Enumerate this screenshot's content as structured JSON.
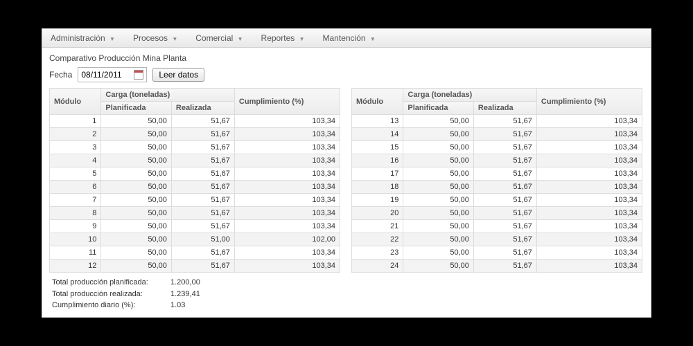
{
  "menu": {
    "items": [
      "Administración",
      "Procesos",
      "Comercial",
      "Reportes",
      "Mantención"
    ]
  },
  "page_title": "Comparativo Producción Mina Planta",
  "controls": {
    "fecha_label": "Fecha",
    "fecha_value": "08/11/2011",
    "leer_label": "Leer datos"
  },
  "table_headers": {
    "modulo": "Módulo",
    "carga": "Carga (toneladas)",
    "planificada": "Planificada",
    "realizada": "Realizada",
    "cumplimiento": "Cumplimiento (%)"
  },
  "rows_left": [
    {
      "m": "1",
      "p": "50,00",
      "r": "51,67",
      "c": "103,34"
    },
    {
      "m": "2",
      "p": "50,00",
      "r": "51,67",
      "c": "103,34"
    },
    {
      "m": "3",
      "p": "50,00",
      "r": "51,67",
      "c": "103,34"
    },
    {
      "m": "4",
      "p": "50,00",
      "r": "51,67",
      "c": "103,34"
    },
    {
      "m": "5",
      "p": "50,00",
      "r": "51,67",
      "c": "103,34"
    },
    {
      "m": "6",
      "p": "50,00",
      "r": "51,67",
      "c": "103,34"
    },
    {
      "m": "7",
      "p": "50,00",
      "r": "51,67",
      "c": "103,34"
    },
    {
      "m": "8",
      "p": "50,00",
      "r": "51,67",
      "c": "103,34"
    },
    {
      "m": "9",
      "p": "50,00",
      "r": "51,67",
      "c": "103,34"
    },
    {
      "m": "10",
      "p": "50,00",
      "r": "51,00",
      "c": "102,00"
    },
    {
      "m": "11",
      "p": "50,00",
      "r": "51,67",
      "c": "103,34"
    },
    {
      "m": "12",
      "p": "50,00",
      "r": "51,67",
      "c": "103,34"
    }
  ],
  "rows_right": [
    {
      "m": "13",
      "p": "50,00",
      "r": "51,67",
      "c": "103,34"
    },
    {
      "m": "14",
      "p": "50,00",
      "r": "51,67",
      "c": "103,34"
    },
    {
      "m": "15",
      "p": "50,00",
      "r": "51,67",
      "c": "103,34"
    },
    {
      "m": "16",
      "p": "50,00",
      "r": "51,67",
      "c": "103,34"
    },
    {
      "m": "17",
      "p": "50,00",
      "r": "51,67",
      "c": "103,34"
    },
    {
      "m": "18",
      "p": "50,00",
      "r": "51,67",
      "c": "103,34"
    },
    {
      "m": "19",
      "p": "50,00",
      "r": "51,67",
      "c": "103,34"
    },
    {
      "m": "20",
      "p": "50,00",
      "r": "51,67",
      "c": "103,34"
    },
    {
      "m": "21",
      "p": "50,00",
      "r": "51,67",
      "c": "103,34"
    },
    {
      "m": "22",
      "p": "50,00",
      "r": "51,67",
      "c": "103,34"
    },
    {
      "m": "23",
      "p": "50,00",
      "r": "51,67",
      "c": "103,34"
    },
    {
      "m": "24",
      "p": "50,00",
      "r": "51,67",
      "c": "103,34"
    }
  ],
  "totals": {
    "planificada_label": "Total producción planificada:",
    "planificada_value": "1.200,00",
    "realizada_label": "Total producción realizada:",
    "realizada_value": "1.239,41",
    "cumplimiento_label": "Cumplimiento diario (%):",
    "cumplimiento_value": "1.03"
  }
}
